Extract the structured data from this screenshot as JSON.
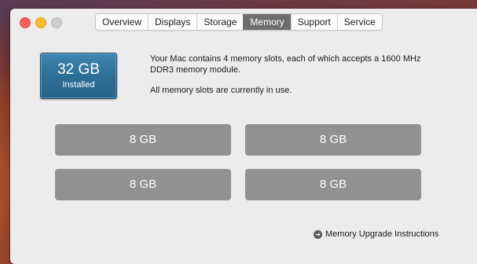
{
  "window": {
    "tabs": [
      {
        "label": "Overview",
        "active": false
      },
      {
        "label": "Displays",
        "active": false
      },
      {
        "label": "Storage",
        "active": false
      },
      {
        "label": "Memory",
        "active": true
      },
      {
        "label": "Support",
        "active": false
      },
      {
        "label": "Service",
        "active": false
      }
    ]
  },
  "memory": {
    "installed_size": "32 GB",
    "installed_label": "Installed",
    "description_line1": "Your Mac contains 4 memory slots, each of which accepts a 1600 MHz DDR3 memory module.",
    "description_line2": "All memory slots are currently in use.",
    "slots": [
      "8 GB",
      "8 GB",
      "8 GB",
      "8 GB"
    ],
    "upgrade_link": "Memory Upgrade Instructions"
  },
  "colors": {
    "installed_box": "#2e6f97",
    "slot": "#919191",
    "active_tab": "#6e6e6e"
  }
}
